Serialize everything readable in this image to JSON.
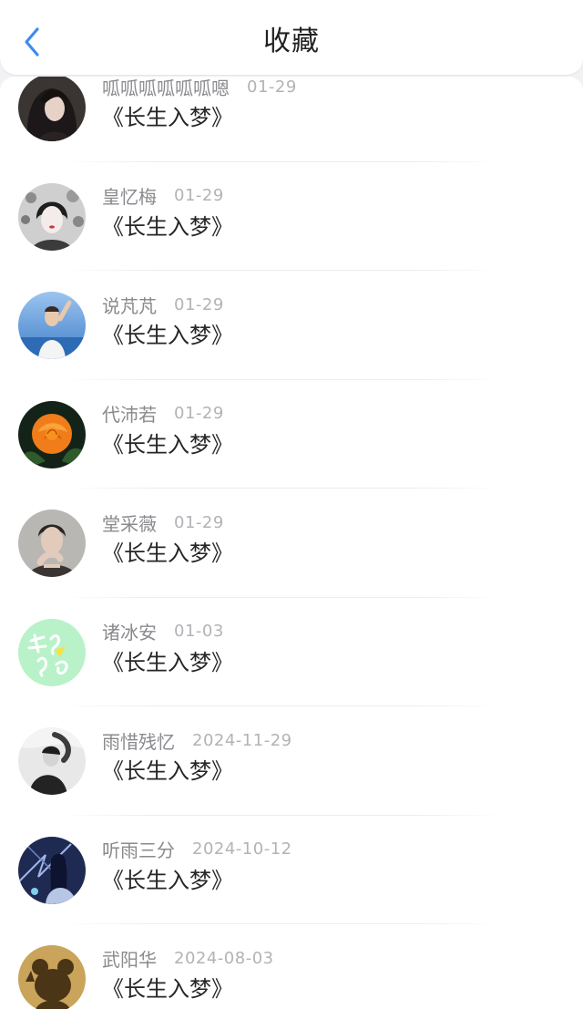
{
  "header": {
    "title": "收藏",
    "back_icon": "chevron-left-icon",
    "accent": "#3d8bf2"
  },
  "favorites": [
    {
      "name": "呱呱呱呱呱呱嗯",
      "date": "01-29",
      "title": "《长生入梦》",
      "avatar": "portrait-woman-dark-hair"
    },
    {
      "name": "皇忆梅",
      "date": "01-29",
      "title": "《长生入梦》",
      "avatar": "portrait-woman-monochrome"
    },
    {
      "name": "说芃芃",
      "date": "01-29",
      "title": "《长生入梦》",
      "avatar": "portrait-man-sky-background"
    },
    {
      "name": "代沛若",
      "date": "01-29",
      "title": "《长生入梦》",
      "avatar": "orange-rose"
    },
    {
      "name": "堂采薇",
      "date": "01-29",
      "title": "《长生入梦》",
      "avatar": "portrait-man-hand-on-chin"
    },
    {
      "name": "诸冰安",
      "date": "01-03",
      "title": "《长生入梦》",
      "avatar": "green-calligraphy"
    },
    {
      "name": "雨惜残忆",
      "date": "2024-11-29",
      "title": "《长生入梦》",
      "avatar": "portrait-monochrome-figure"
    },
    {
      "name": "听雨三分",
      "date": "2024-10-12",
      "title": "《长生入梦》",
      "avatar": "illustrated-figure-night"
    },
    {
      "name": "武阳华",
      "date": "2024-08-03",
      "title": "《长生入梦》",
      "avatar": "bear-silhouette-gold"
    }
  ]
}
